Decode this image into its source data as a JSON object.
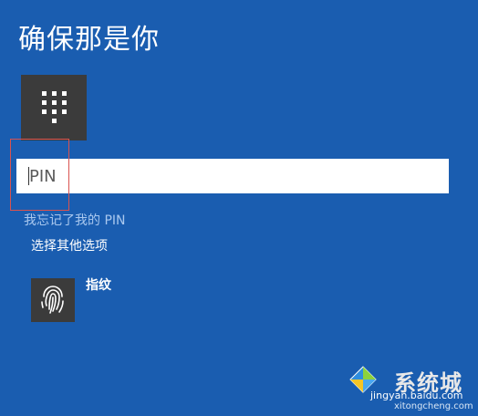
{
  "title": "确保那是你",
  "icons": {
    "pin_keypad": "pin-keypad-icon",
    "fingerprint": "fingerprint-icon"
  },
  "pin_field": {
    "placeholder": "PIN",
    "value": ""
  },
  "links": {
    "forgot_pin": "我忘记了我的 PIN",
    "other_options": "选择其他选项"
  },
  "options": [
    {
      "label": "指纹",
      "icon": "fingerprint-icon"
    }
  ],
  "watermark": {
    "brand": "系统城",
    "site": "jingyan.baidu.com",
    "sub": "xitongcheng.com"
  },
  "colors": {
    "background": "#1a5db0",
    "tile": "#3b3b3b",
    "link": "#a9c8ef",
    "highlight_box": "#d9534f"
  }
}
